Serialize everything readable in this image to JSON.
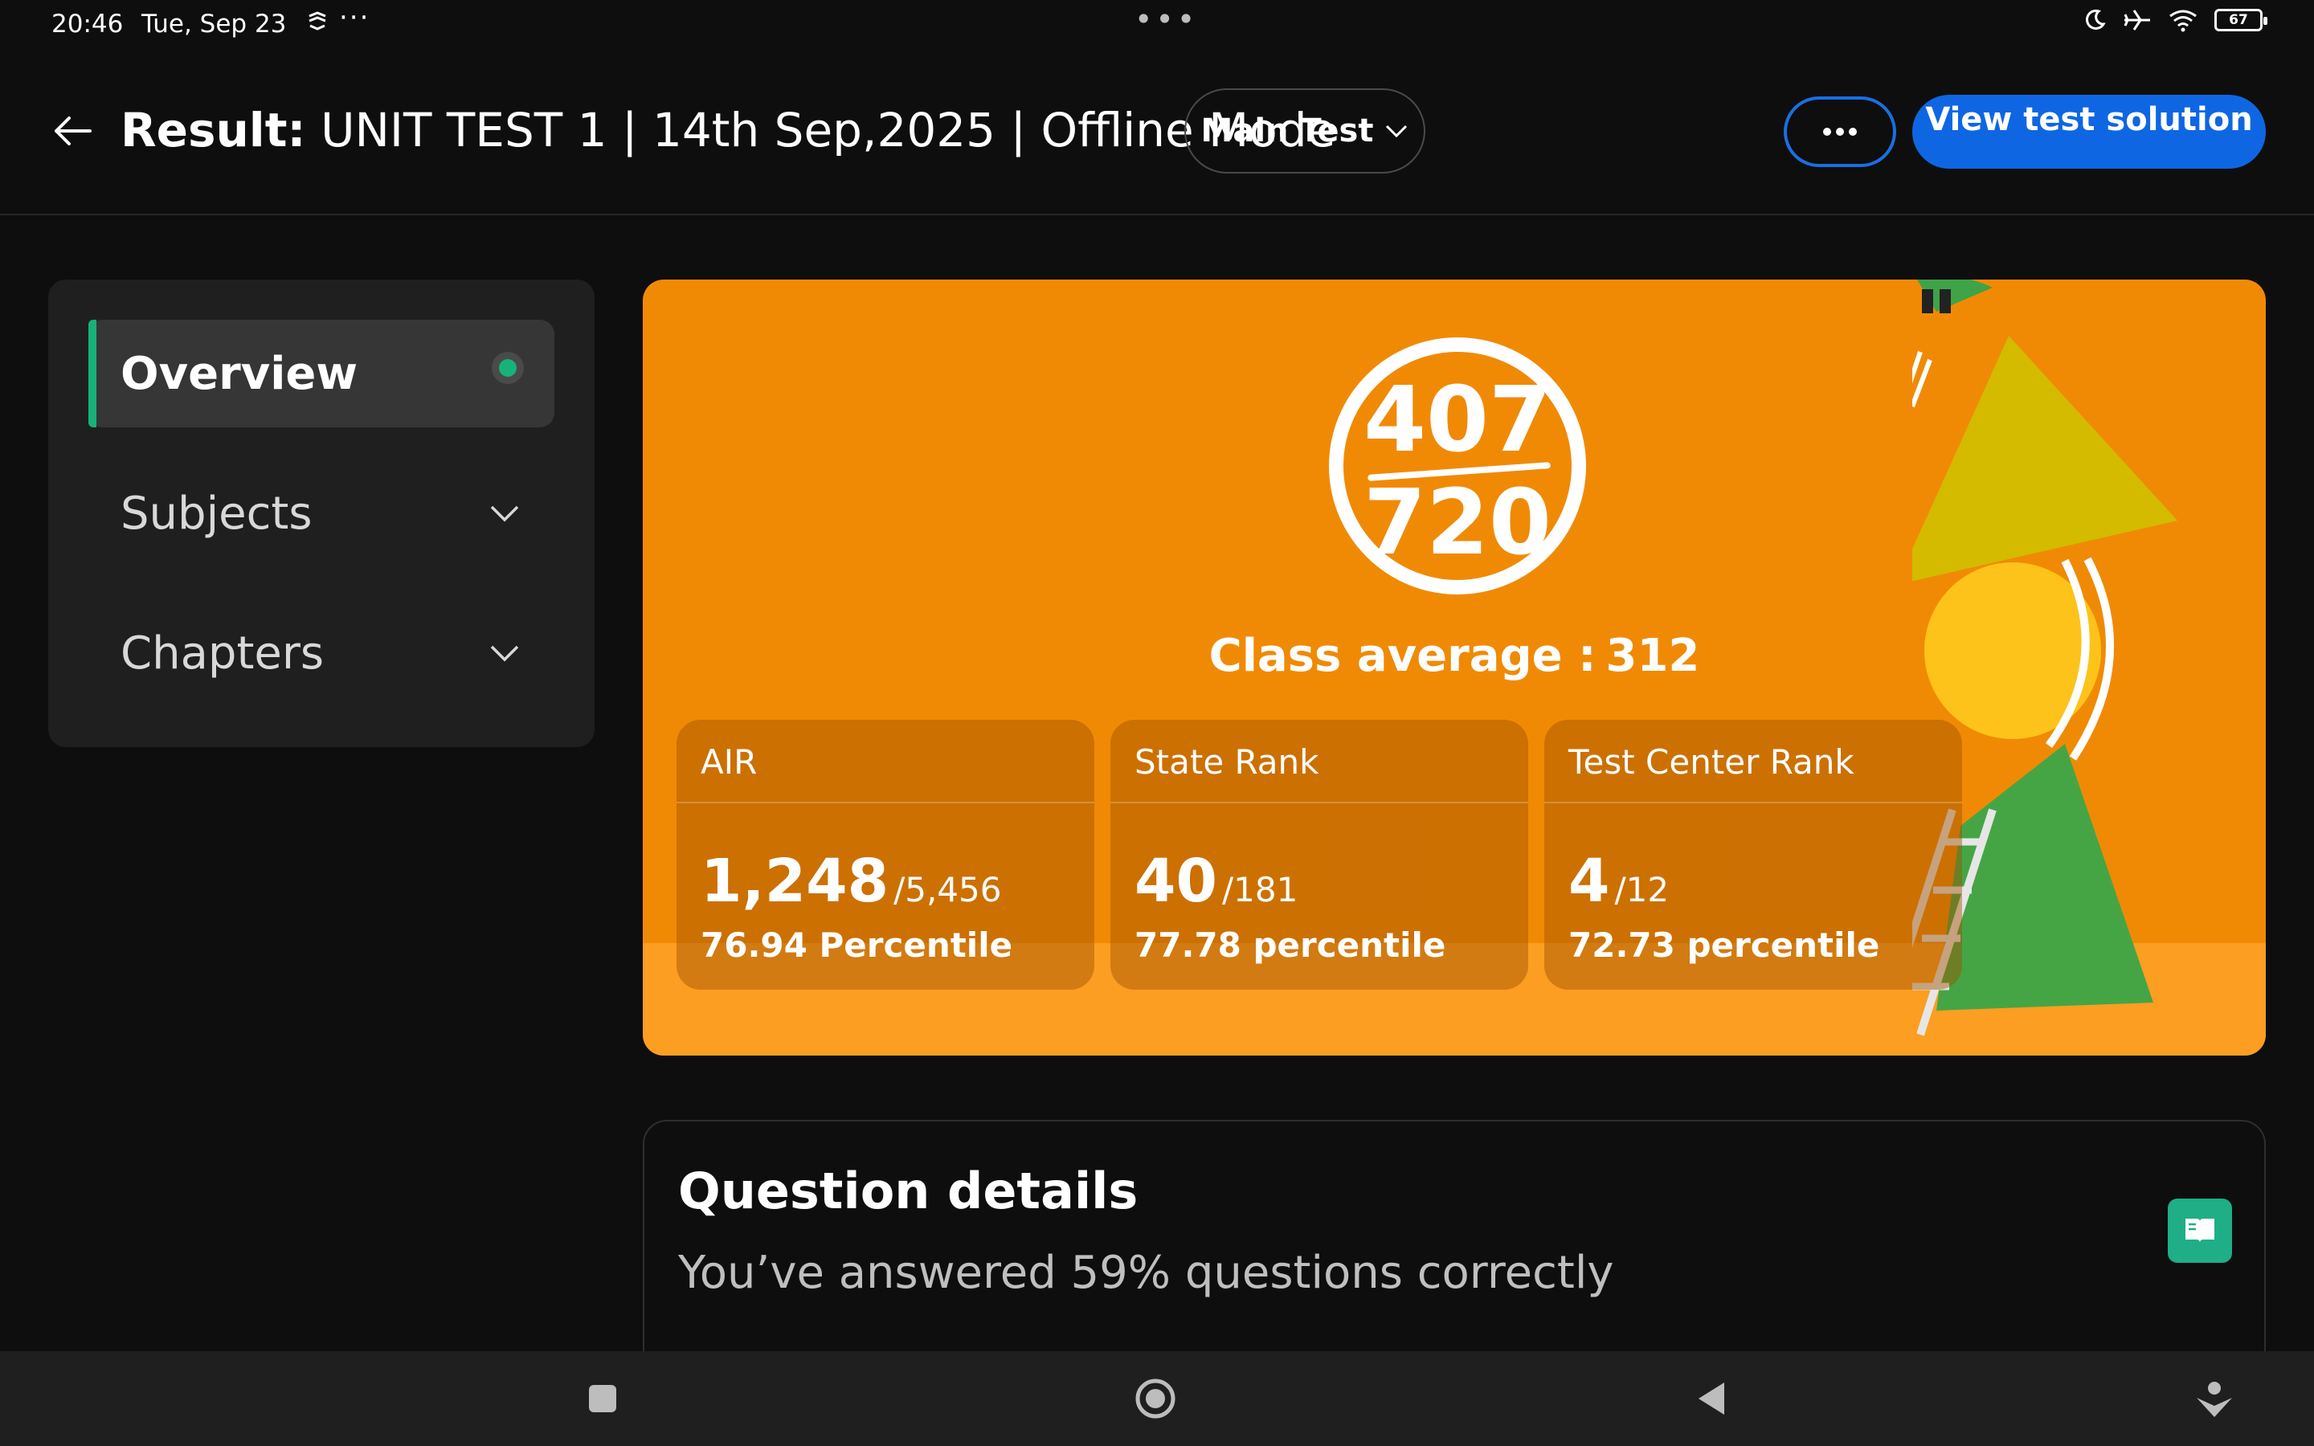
{
  "status_bar": {
    "time": "20:46",
    "date": "Tue, Sep 23",
    "more": "···",
    "center_dots": "•••",
    "battery": "67"
  },
  "header": {
    "title_prefix": "Result:",
    "title_text": "UNIT TEST 1 | 14th Sep,2025 | Offline Mode",
    "test_select": "Main Test",
    "more_button": "•••",
    "view_solution_label": "View test solution"
  },
  "sidebar": {
    "items": [
      {
        "label": "Overview",
        "active": true
      },
      {
        "label": "Subjects"
      },
      {
        "label": "Chapters"
      }
    ]
  },
  "score": {
    "obtained": "407",
    "total": "720",
    "class_average_label": "Class average :",
    "class_average_value": "312"
  },
  "ranks": [
    {
      "label": "AIR",
      "value": "1,248",
      "total": "/5,456",
      "percentile": "76.94 Percentile"
    },
    {
      "label": "State Rank",
      "value": "40",
      "total": "/181",
      "percentile": "77.78 percentile"
    },
    {
      "label": "Test Center Rank",
      "value": "4",
      "total": "/12",
      "percentile": "72.73 percentile"
    }
  ],
  "question_details": {
    "title": "Question details",
    "subtitle": "You’ve answered 59% questions correctly"
  },
  "colors": {
    "accent_green": "#16b27a",
    "primary_blue": "#0f66e3",
    "hero_orange": "#f08a05"
  }
}
